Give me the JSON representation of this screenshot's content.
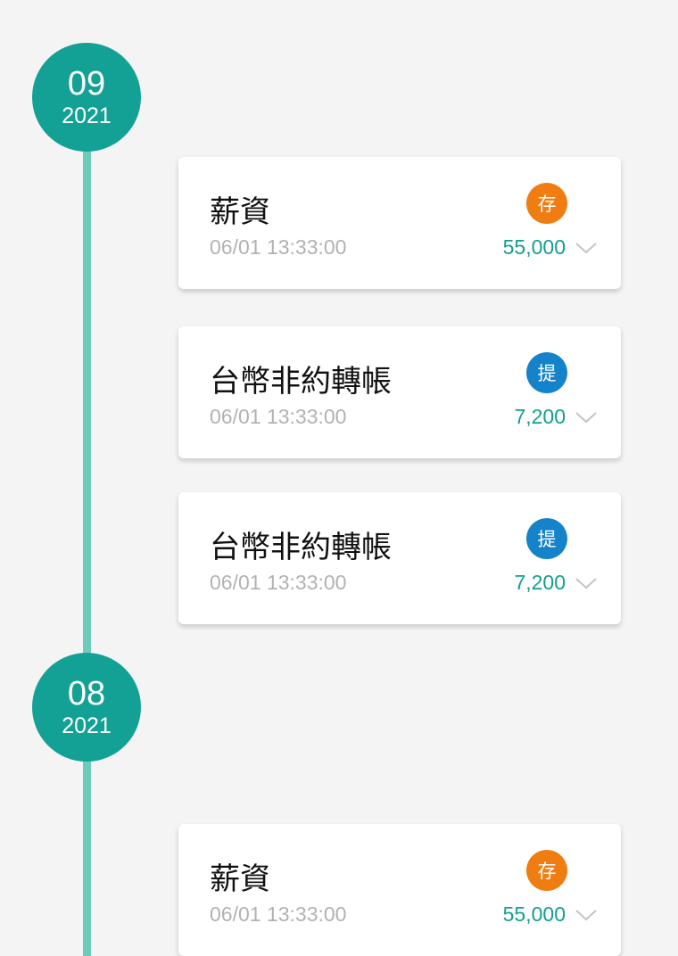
{
  "colors": {
    "background": "#f4f4f4",
    "timeline_line": "#6ccbbb",
    "month_circle": "#14a195",
    "amount_text": "#139e92",
    "deposit_badge": "#f07d11",
    "withdraw_badge": "#1583c9"
  },
  "months": [
    {
      "month": "09",
      "year": "2021",
      "transactions": [
        {
          "title": "薪資",
          "time": "06/01 13:33:00",
          "badge": "存",
          "badge_type": "deposit",
          "amount": "55,000",
          "icon": "chevron-down-icon"
        },
        {
          "title": "台幣非約轉帳",
          "time": "06/01 13:33:00",
          "badge": "提",
          "badge_type": "withdraw",
          "amount": "7,200",
          "icon": "chevron-down-icon"
        },
        {
          "title": "台幣非約轉帳",
          "time": "06/01 13:33:00",
          "badge": "提",
          "badge_type": "withdraw",
          "amount": "7,200",
          "icon": "chevron-down-icon"
        }
      ]
    },
    {
      "month": "08",
      "year": "2021",
      "transactions": [
        {
          "title": "薪資",
          "time": "06/01 13:33:00",
          "badge": "存",
          "badge_type": "deposit",
          "amount": "55,000",
          "icon": "chevron-down-icon"
        }
      ]
    }
  ]
}
